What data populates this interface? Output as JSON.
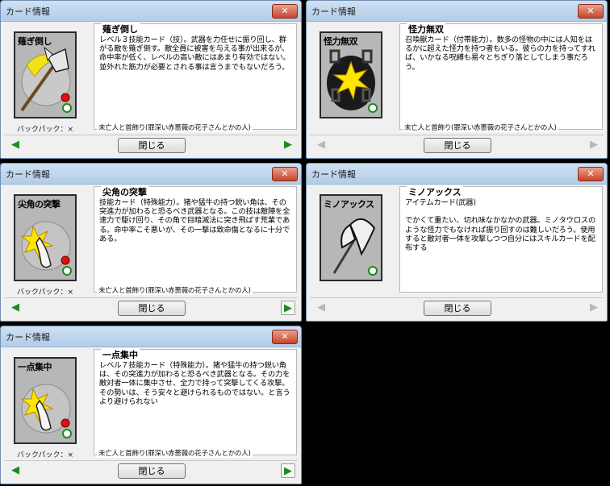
{
  "window_title": "カード情報",
  "close_glyph": "✕",
  "close_button_label": "閉じる",
  "prev_glyph": "◀",
  "next_glyph": "▶",
  "backpack_label": "バックパック：×",
  "cards": [
    {
      "name": "薙ぎ倒し",
      "card_title": "薙ぎ倒し",
      "description": "レベル３技能カード（技）。武器を力任せに振り回し、群がる敵を薙ぎ倒す。敵全員に被害を与える事が出来るが、命中率が低く、レベルの高い敵にはあまり有効ではない。並外れた筋力が必要とされる事は言うまでもないだろう。",
      "author": "未亡人と首飾り(罪深い赤薔薇の花子さんとかの人)",
      "show_backpack": true,
      "prev_enabled": true,
      "next_enabled": true,
      "icon": "axe-icon"
    },
    {
      "name": "怪力無双",
      "card_title": "怪力無双",
      "description": "召喚獣カード（付帯能力）。数多の怪物の中には人知をはるかに超えた怪力を持つ者もいる。彼らの力を持ってすれば、いかなる呪縛も易々とちぎり落としてしまう事だろう。",
      "author": "未亡人と首飾り(罪深い赤薔薇の花子さんとかの人)",
      "show_backpack": false,
      "prev_enabled": false,
      "next_enabled": false,
      "icon": "broken-chain-icon"
    },
    {
      "name": "尖角の突撃",
      "card_title": "尖角の突撃",
      "description": "技能カード（特殊能力）。猪や猛牛の持つ鋭い角は、その突進力が加わると恐るべき武器となる。この技は敵陣を全速力で駆け回り、その角で目暗滅法に突き飛ばす荒業である。命中率こそ悪いが、その一撃は致命傷となるに十分である。",
      "author": "未亡人と首飾り(罪深い赤薔薇の花子さんとかの人)",
      "show_backpack": true,
      "prev_enabled": true,
      "next_enabled": true,
      "icon": "horn-icon"
    },
    {
      "name": "ミノアックス",
      "card_title": "ミノアックス",
      "description": "アイテムカード(武器)\n\nでかくて重たい、切れ味なかなかの武器。ミノタウロスのような怪力でもなければ振り回すのは難しいだろう。使用すると敵対者一体を攻撃しつつ自分にはスキルカードを配布する",
      "author": "未亡人と首飾り(罪深い赤薔薇の花子さんとかの人)",
      "show_backpack": false,
      "prev_enabled": false,
      "next_enabled": false,
      "icon": "battle-axe-icon"
    },
    {
      "name": "一点集中",
      "card_title": "一点集中",
      "description": "レベル７技能カード（特殊能力）。猪や猛牛の持つ鋭い角は、その突進力が加わると恐るべき武器となる。その力を敵対者一体に集中させ、全力で持って突撃してくる攻撃。その勢いは、そう安々と避けられるものではない。と言うより避けられない",
      "author": "未亡人と首飾り(罪深い赤薔薇の花子さんとかの人)",
      "show_backpack": true,
      "prev_enabled": true,
      "next_enabled": true,
      "icon": "horn-icon"
    }
  ]
}
